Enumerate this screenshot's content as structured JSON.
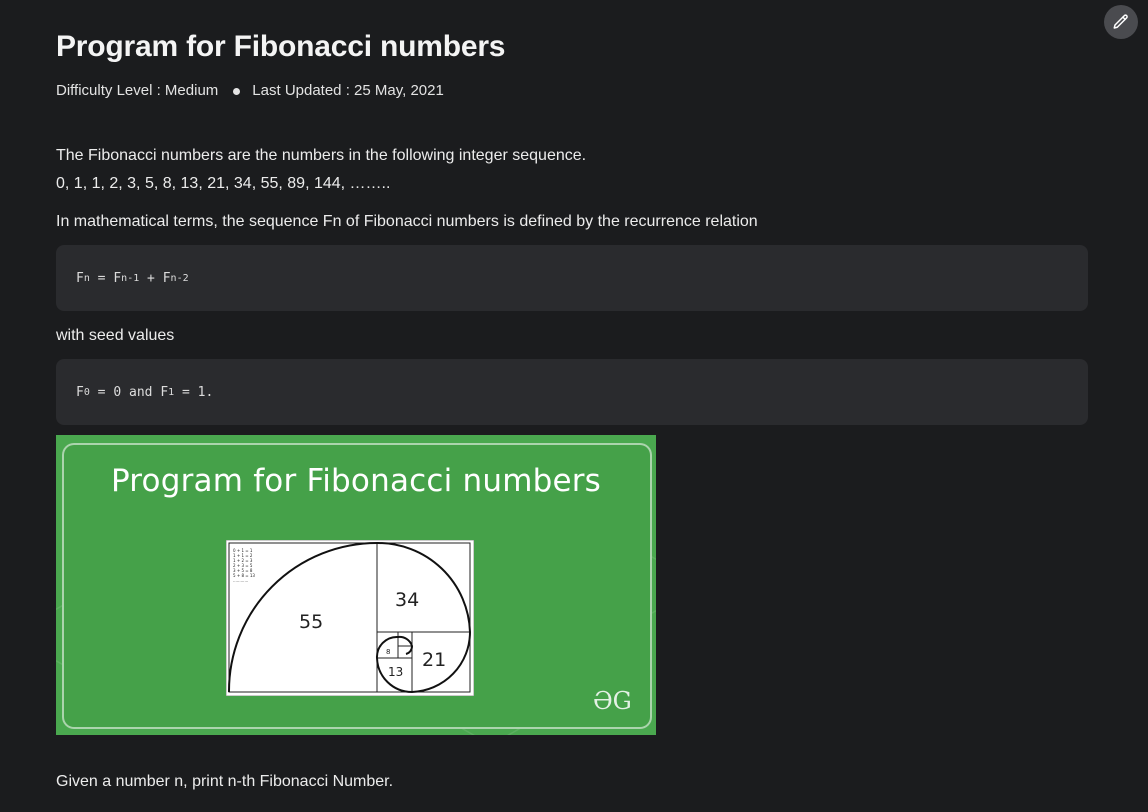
{
  "header": {
    "title": "Program for Fibonacci numbers",
    "difficulty": "Difficulty Level : Medium",
    "last_updated": "Last Updated : 25 May, 2021"
  },
  "content": {
    "intro": "The Fibonacci numbers are the numbers in the following integer sequence.",
    "sequence": "0, 1, 1, 2, 3, 5, 8, 13, 21, 34, 55, 89, 144, ……..",
    "math_terms": "In mathematical terms, the sequence Fn of Fibonacci numbers is defined by the recurrence relation",
    "seed_label": "with seed values",
    "task": "Given a number n, print n-th Fibonacci Number."
  },
  "code_blocks": {
    "recurrence": {
      "F": "F",
      "n": "n",
      "eq": " = ",
      "F1": "F",
      "n1": "n-1",
      "plus": " + ",
      "F2": "F",
      "n2": "n-2"
    },
    "seeds": {
      "F": "F",
      "s0": "0",
      "mid": " = 0 and ",
      "F1": "F",
      "s1": "1",
      "end": " = 1."
    }
  },
  "banner": {
    "title": "Program for Fibonacci numbers",
    "logo": "ƏG",
    "labels": {
      "l55": "55",
      "l34": "34",
      "l21": "21",
      "l13": "13",
      "l8": "8"
    },
    "sums": [
      "0 + 1 = 1",
      "1 + 1 = 2",
      "1 + 2 = 3",
      "2 + 3 = 5",
      "3 + 5 = 8",
      "5 + 8 = 13",
      "............"
    ],
    "colors": {
      "green": "#4aa84f",
      "green_inner": "#45a149"
    }
  },
  "toolbar": {
    "edit_icon": "pencil-icon"
  }
}
